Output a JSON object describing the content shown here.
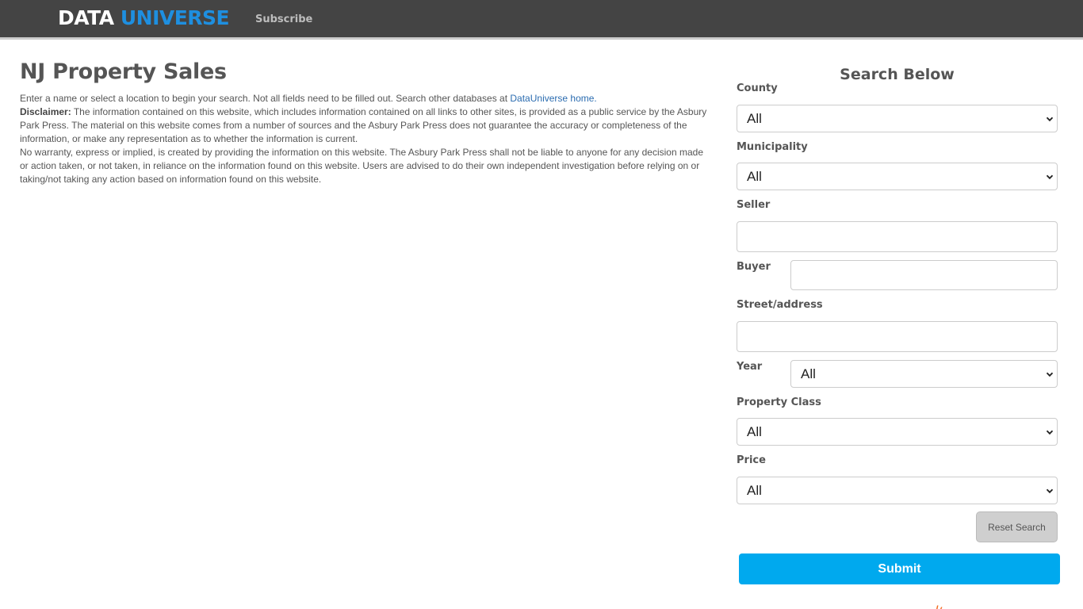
{
  "header": {
    "logo_part1": "DATA",
    "logo_part2": "UNIVERSE",
    "nav_subscribe": "Subscribe",
    "logo_color": "#1e8fe0",
    "bar_color": "#444444"
  },
  "main": {
    "title": "NJ Property Sales",
    "intro_text": "Enter a name or select a location to begin your search. Not all fields need to be filled out. Search other databases at ",
    "intro_link": "DataUniverse home.",
    "disclaimer_label": "Disclaimer:",
    "disclaimer_text": " The information contained on this website, which includes information contained on all links to other sites, is provided as a public service by the Asbury Park Press.  The material on this website comes from a number of sources and the Asbury Park Press does not guarantee the accuracy or completeness of the information, or make any representation as to whether the information is current.",
    "warranty_text": "No warranty, express or implied, is created by providing the information on this website. The Asbury Park Press shall not be liable to anyone for any decision made or action taken, or not taken, in reliance on the information found on this website.  Users are advised to do their own independent investigation before relying on or taking/not taking any action based on information found on this website."
  },
  "search": {
    "heading": "Search Below",
    "county": {
      "label": "County",
      "value": "All"
    },
    "municipality": {
      "label": "Municipality",
      "value": "All"
    },
    "seller": {
      "label": "Seller",
      "value": ""
    },
    "buyer": {
      "label": "Buyer",
      "value": ""
    },
    "street": {
      "label": "Street/address",
      "value": ""
    },
    "year": {
      "label": "Year",
      "value": "All"
    },
    "property_class": {
      "label": "Property Class",
      "value": "All"
    },
    "price": {
      "label": "Price",
      "value": "All"
    },
    "reset_label": "Reset Search",
    "submit_label": "Submit",
    "submit_color": "#00a9ee"
  }
}
